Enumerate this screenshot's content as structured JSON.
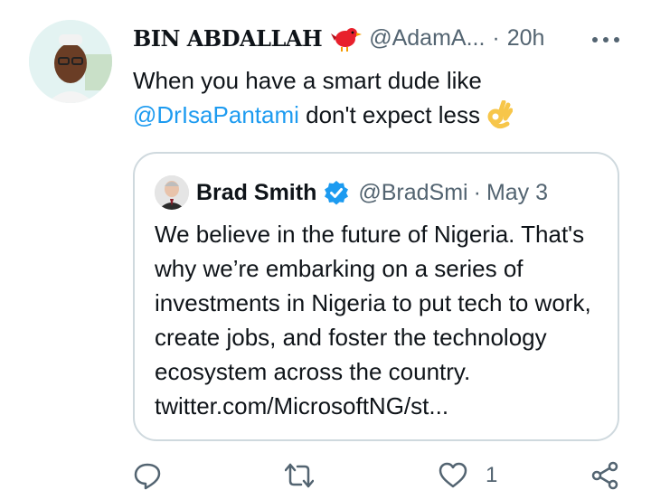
{
  "tweet": {
    "display_name": "BIN ABDALLAH",
    "name_emoji": "bird-icon",
    "handle": "@AdamA...",
    "separator": "·",
    "time": "20h",
    "more_icon": "more-dots-icon",
    "text_before": "When you have a smart dude like ",
    "mention": "@DrIsaPantami",
    "text_after": " don't expect less",
    "text_emoji": "ok-hand-icon"
  },
  "quote": {
    "display_name": "Brad Smith",
    "verified_icon": "verified-badge-icon",
    "handle": "@BradSmi",
    "separator": "·",
    "date": "May 3",
    "text": "We believe in the future of Nigeria. That's why we’re embarking on a series of investments in Nigeria to put tech to work, create jobs, and foster the technology ecosystem across the country. ",
    "link": "twitter.com/MicrosoftNG/st..."
  },
  "actions": {
    "reply_icon": "reply-icon",
    "retweet_icon": "retweet-icon",
    "like_icon": "heart-icon",
    "like_count": "1",
    "share_icon": "share-icon"
  },
  "colors": {
    "link_blue": "#1d9bf0",
    "secondary_text": "#536471",
    "border": "#cfd9de"
  }
}
